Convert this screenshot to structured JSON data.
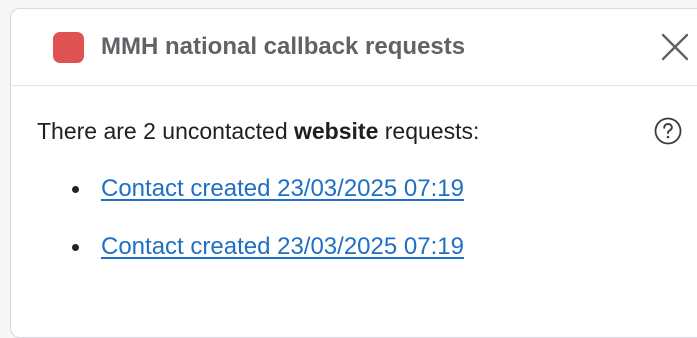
{
  "header": {
    "title": "MMH national callback requests",
    "status_color": "#e05252",
    "status_icon": "red-status-square",
    "close_icon": "close-x-icon"
  },
  "body": {
    "message_prefix": "There are 2 uncontacted ",
    "message_bold": "website",
    "message_suffix": " requests:",
    "help_icon": "question-circle-icon",
    "requests": [
      {
        "label": "Contact created 23/03/2025 07:19"
      },
      {
        "label": "Contact created 23/03/2025 07:19"
      }
    ]
  },
  "colors": {
    "link": "#1f6fc5",
    "title": "#5f6368",
    "text": "#1f1f1f"
  }
}
